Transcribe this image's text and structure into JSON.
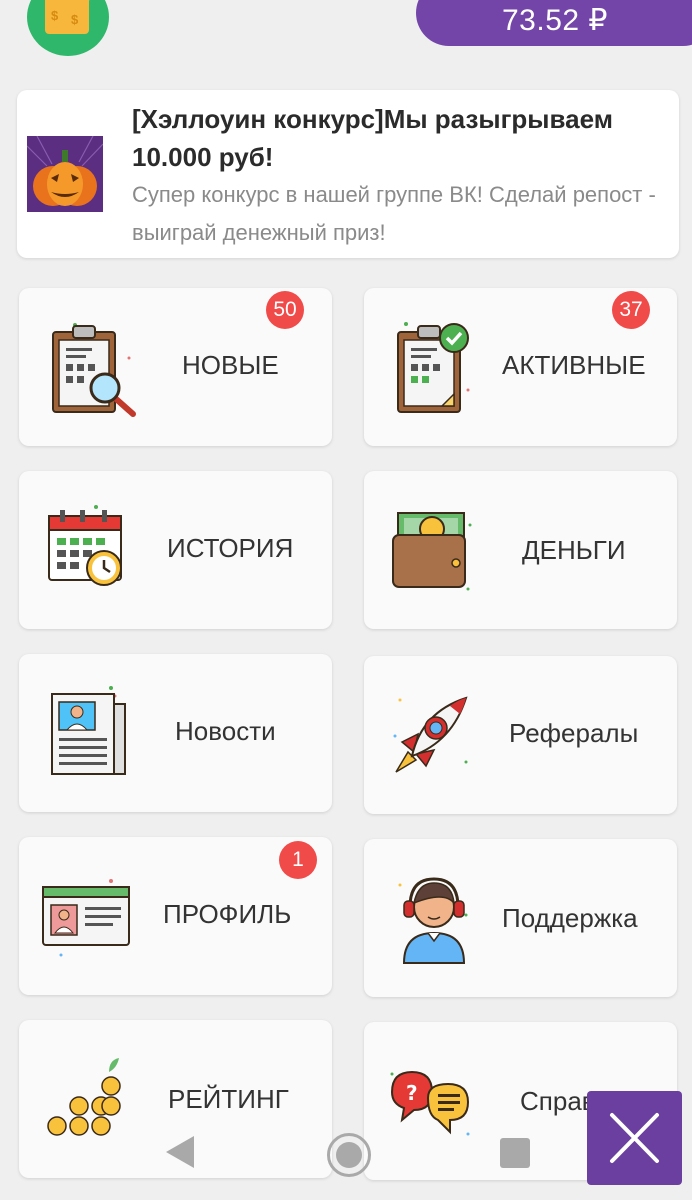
{
  "header": {
    "balance": "73.52 ₽"
  },
  "promo": {
    "title": "[Хэллоуин конкурс]Мы разыгрываем 10.000 руб!",
    "description": "Супер конкурс в нашей группе ВК! Сделай репост - выиграй денежный приз!"
  },
  "menu": {
    "new": {
      "label": "НОВЫЕ",
      "badge": "50"
    },
    "active": {
      "label": "АКТИВНЫЕ",
      "badge": "37"
    },
    "history": {
      "label": "ИСТОРИЯ"
    },
    "money": {
      "label": "ДЕНЬГИ"
    },
    "news": {
      "label": "Новости"
    },
    "referrals": {
      "label": "Рефералы"
    },
    "profile": {
      "label": "ПРОФИЛЬ",
      "badge": "1"
    },
    "support": {
      "label": "Поддержка"
    },
    "rating": {
      "label": "РЕЙТИНГ"
    },
    "help": {
      "label": "Справка"
    }
  },
  "colors": {
    "accent": "#7445a8",
    "badge": "#f04a49",
    "background": "#efefef"
  }
}
